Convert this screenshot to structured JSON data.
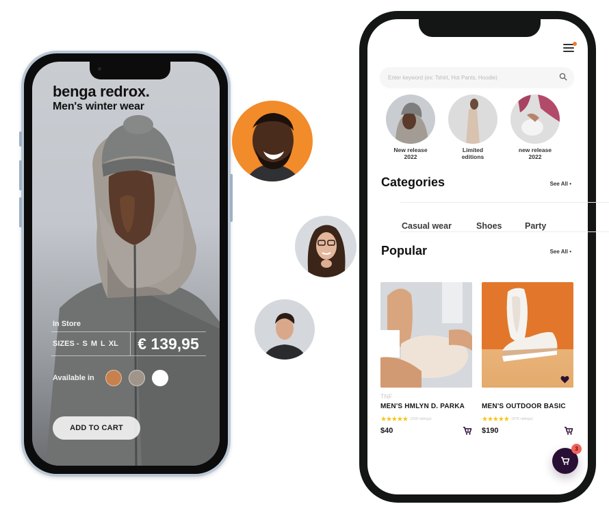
{
  "left_phone": {
    "brand": "benga redrox.",
    "subtitle": "Men's winter wear",
    "in_store_label": "In Store",
    "sizes_label": "SIZES -",
    "sizes": [
      "S",
      "M",
      "L",
      "XL"
    ],
    "price": "€ 139,95",
    "available_label": "Available in",
    "colors": [
      "#c8804c",
      "#a1948a",
      "#ffffff"
    ],
    "add_to_cart_label": "ADD TO CART"
  },
  "avatars": [
    {
      "name": "smiling-man-orange-bg",
      "bg": "#f28b2a"
    },
    {
      "name": "woman-with-glasses",
      "bg": "#d7dbe0"
    },
    {
      "name": "young-man",
      "bg": "#d4d7dc"
    }
  ],
  "right_phone": {
    "search": {
      "placeholder": "Enter keyword (ex: Tshirt, Hot Pants, Hoodie)"
    },
    "menu_icon": "hamburger-menu-icon",
    "stories": [
      {
        "line1": "New release",
        "line2": "2022"
      },
      {
        "line1": "Limited",
        "line2": "editions"
      },
      {
        "line1": "new release",
        "line2": "2022"
      }
    ],
    "categories_title": "Categories",
    "see_all_label": "See All •",
    "categories": [
      "Casual wear",
      "Shoes",
      "Party"
    ],
    "popular_title": "Popular",
    "products": [
      {
        "tag": "TNF",
        "name": "MEN'S HMLYN D. PARKA",
        "stars": "★★★★★",
        "ratings": "(209 ratings)",
        "price": "$40",
        "favorite": false
      },
      {
        "tag": "",
        "name": "MEN'S OUTDOOR BASIC",
        "stars": "★★★★★",
        "ratings": "(976 ratings)",
        "price": "$190",
        "favorite": true
      }
    ],
    "cart_count": "3",
    "accent": "#2a0f35",
    "badge_color": "#f2625d",
    "notification_dot": "#f07a2e"
  }
}
